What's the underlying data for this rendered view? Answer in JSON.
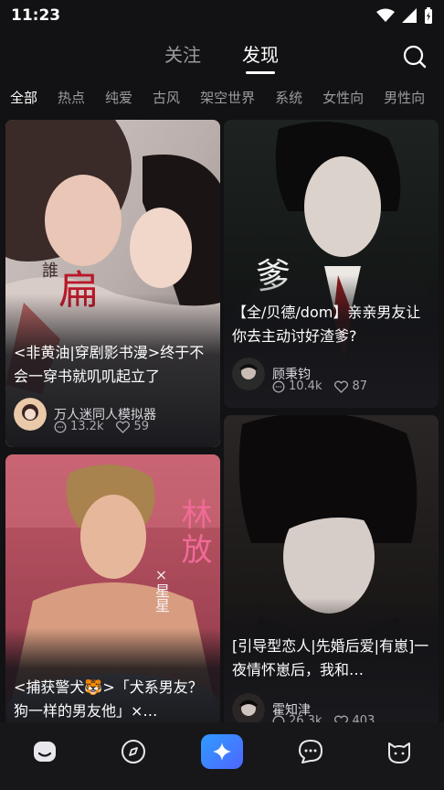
{
  "status": {
    "time": "11:23"
  },
  "tabs": [
    {
      "label": "关注",
      "active": false
    },
    {
      "label": "发现",
      "active": true
    }
  ],
  "categories": [
    "全部",
    "热点",
    "纯爱",
    "古风",
    "架空世界",
    "系统",
    "女性向",
    "男性向"
  ],
  "cards": [
    {
      "title": "<非黄油|穿剧影书漫>终于不会一穿书就叽叽起立了",
      "author": "万人迷同人模拟器",
      "views": "13.2k",
      "likes": "59",
      "cover_overlay": "扁"
    },
    {
      "title": "【全/贝德/dom】亲亲男友让你去主动讨好渣爹?",
      "author": "顾秉钧",
      "views": "10.4k",
      "likes": "87",
      "cover_overlay": "爹"
    },
    {
      "title": "<捕获警犬🐯>「犬系男友？狗一样的男友他」×…",
      "cover_overlay": "林放",
      "cover_overlay_sub": "×星星"
    },
    {
      "title": "[引导型恋人|先婚后爱|有崽]一夜情怀崽后，我和…",
      "author": "霍知津",
      "views": "26.3k",
      "likes": "403"
    }
  ],
  "nav": [
    "home-icon",
    "compass-icon",
    "sparkle-icon",
    "chat-icon",
    "cat-icon"
  ],
  "colors": {
    "background": "#121214",
    "card": "#1d1d21",
    "accent": "#3b82ff",
    "muted": "#9a9aa0"
  }
}
